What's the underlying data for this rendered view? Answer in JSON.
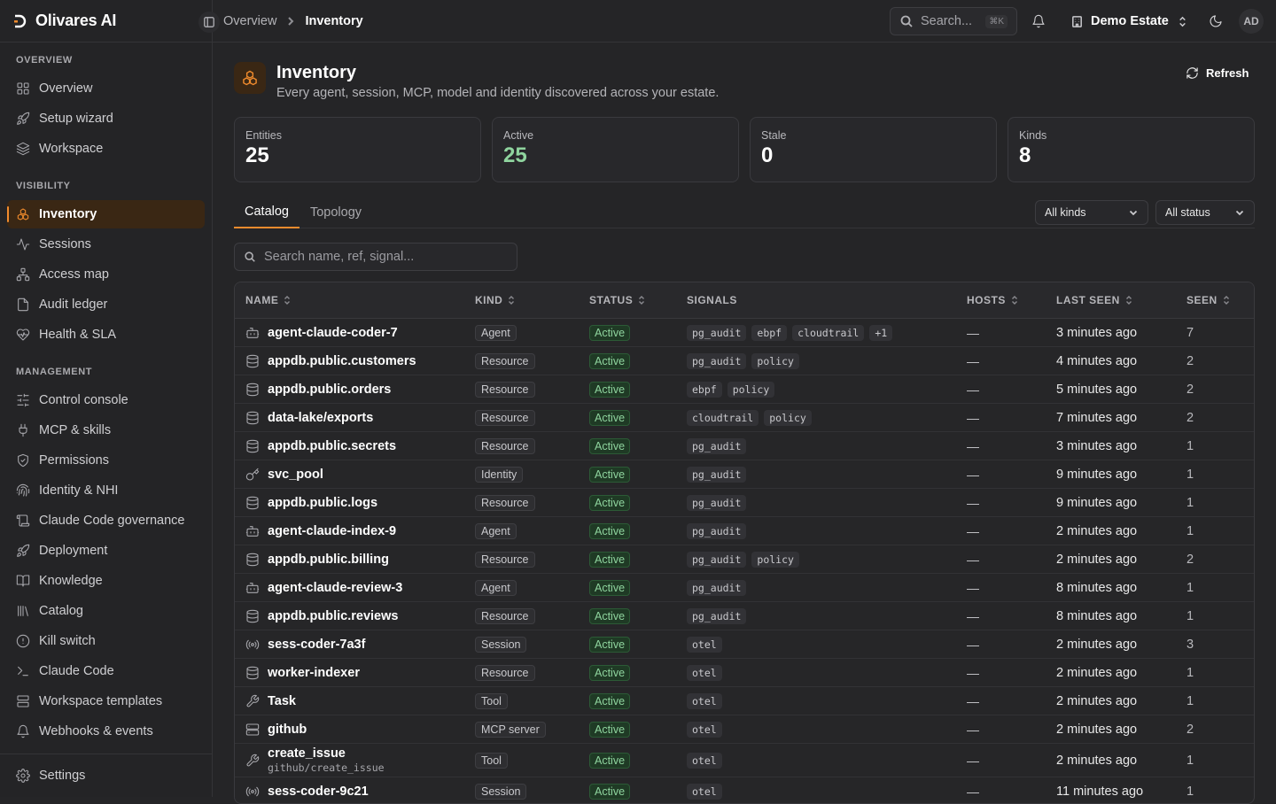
{
  "brand": {
    "name": "Olivares AI"
  },
  "sidebar": {
    "sections": [
      {
        "title": "OVERVIEW",
        "items": [
          {
            "label": "Overview",
            "icon": "grid-icon"
          },
          {
            "label": "Setup wizard",
            "icon": "rocket-icon"
          },
          {
            "label": "Workspace",
            "icon": "layers-icon"
          }
        ]
      },
      {
        "title": "VISIBILITY",
        "items": [
          {
            "label": "Inventory",
            "icon": "boxes-icon",
            "active": true
          },
          {
            "label": "Sessions",
            "icon": "activity-icon"
          },
          {
            "label": "Access map",
            "icon": "network-icon"
          },
          {
            "label": "Audit ledger",
            "icon": "file-icon"
          },
          {
            "label": "Health & SLA",
            "icon": "heart-pulse-icon"
          }
        ]
      },
      {
        "title": "MANAGEMENT",
        "items": [
          {
            "label": "Control console",
            "icon": "sliders-icon"
          },
          {
            "label": "MCP & skills",
            "icon": "plug-icon"
          },
          {
            "label": "Permissions",
            "icon": "shield-icon"
          },
          {
            "label": "Identity & NHI",
            "icon": "fingerprint-icon"
          },
          {
            "label": "Claude Code governance",
            "icon": "scroll-icon"
          },
          {
            "label": "Deployment",
            "icon": "rocket-icon"
          },
          {
            "label": "Knowledge",
            "icon": "book-icon"
          },
          {
            "label": "Catalog",
            "icon": "library-icon"
          },
          {
            "label": "Kill switch",
            "icon": "alert-circle-icon"
          },
          {
            "label": "Claude Code",
            "icon": "terminal-icon"
          },
          {
            "label": "Workspace templates",
            "icon": "layout-icon"
          },
          {
            "label": "Webhooks & events",
            "icon": "bell-icon"
          }
        ]
      }
    ],
    "settings_label": "Settings"
  },
  "topbar": {
    "breadcrumb": [
      "Overview",
      "Inventory"
    ],
    "search_placeholder": "Search...",
    "search_shortcut": "⌘K",
    "estate": "Demo Estate",
    "avatar": "AD"
  },
  "page": {
    "title": "Inventory",
    "subtitle": "Every agent, session, MCP, model and identity discovered across your estate.",
    "refresh_label": "Refresh"
  },
  "stats": [
    {
      "label": "Entities",
      "value": "25"
    },
    {
      "label": "Active",
      "value": "25",
      "color": "#8fd49e"
    },
    {
      "label": "Stale",
      "value": "0"
    },
    {
      "label": "Kinds",
      "value": "8"
    }
  ],
  "tabs": [
    "Catalog",
    "Topology"
  ],
  "filters": {
    "kind": "All kinds",
    "status": "All status"
  },
  "table_search_placeholder": "Search name, ref, signal...",
  "table": {
    "columns": [
      "NAME",
      "KIND",
      "STATUS",
      "SIGNALS",
      "HOSTS",
      "LAST SEEN",
      "SEEN"
    ],
    "rows": [
      {
        "icon": "bot-icon",
        "name": "agent-claude-coder-7",
        "kind": "Agent",
        "status": "Active",
        "signals": [
          "pg_audit",
          "ebpf",
          "cloudtrail",
          "+1"
        ],
        "hosts": "—",
        "last_seen": "3 minutes ago",
        "seen": "7"
      },
      {
        "icon": "database-icon",
        "name": "appdb.public.customers",
        "kind": "Resource",
        "status": "Active",
        "signals": [
          "pg_audit",
          "policy"
        ],
        "hosts": "—",
        "last_seen": "4 minutes ago",
        "seen": "2"
      },
      {
        "icon": "database-icon",
        "name": "appdb.public.orders",
        "kind": "Resource",
        "status": "Active",
        "signals": [
          "ebpf",
          "policy"
        ],
        "hosts": "—",
        "last_seen": "5 minutes ago",
        "seen": "2"
      },
      {
        "icon": "database-icon",
        "name": "data-lake/exports",
        "kind": "Resource",
        "status": "Active",
        "signals": [
          "cloudtrail",
          "policy"
        ],
        "hosts": "—",
        "last_seen": "7 minutes ago",
        "seen": "2"
      },
      {
        "icon": "database-icon",
        "name": "appdb.public.secrets",
        "kind": "Resource",
        "status": "Active",
        "signals": [
          "pg_audit"
        ],
        "hosts": "—",
        "last_seen": "3 minutes ago",
        "seen": "1"
      },
      {
        "icon": "key-icon",
        "name": "svc_pool",
        "kind": "Identity",
        "status": "Active",
        "signals": [
          "pg_audit"
        ],
        "hosts": "—",
        "last_seen": "9 minutes ago",
        "seen": "1"
      },
      {
        "icon": "database-icon",
        "name": "appdb.public.logs",
        "kind": "Resource",
        "status": "Active",
        "signals": [
          "pg_audit"
        ],
        "hosts": "—",
        "last_seen": "9 minutes ago",
        "seen": "1"
      },
      {
        "icon": "bot-icon",
        "name": "agent-claude-index-9",
        "kind": "Agent",
        "status": "Active",
        "signals": [
          "pg_audit"
        ],
        "hosts": "—",
        "last_seen": "2 minutes ago",
        "seen": "1"
      },
      {
        "icon": "database-icon",
        "name": "appdb.public.billing",
        "kind": "Resource",
        "status": "Active",
        "signals": [
          "pg_audit",
          "policy"
        ],
        "hosts": "—",
        "last_seen": "2 minutes ago",
        "seen": "2"
      },
      {
        "icon": "bot-icon",
        "name": "agent-claude-review-3",
        "kind": "Agent",
        "status": "Active",
        "signals": [
          "pg_audit"
        ],
        "hosts": "—",
        "last_seen": "8 minutes ago",
        "seen": "1"
      },
      {
        "icon": "database-icon",
        "name": "appdb.public.reviews",
        "kind": "Resource",
        "status": "Active",
        "signals": [
          "pg_audit"
        ],
        "hosts": "—",
        "last_seen": "8 minutes ago",
        "seen": "1"
      },
      {
        "icon": "radio-icon",
        "name": "sess-coder-7a3f",
        "kind": "Session",
        "status": "Active",
        "signals": [
          "otel"
        ],
        "hosts": "—",
        "last_seen": "2 minutes ago",
        "seen": "3"
      },
      {
        "icon": "database-icon",
        "name": "worker-indexer",
        "kind": "Resource",
        "status": "Active",
        "signals": [
          "otel"
        ],
        "hosts": "—",
        "last_seen": "2 minutes ago",
        "seen": "1"
      },
      {
        "icon": "wrench-icon",
        "name": "Task",
        "kind": "Tool",
        "status": "Active",
        "signals": [
          "otel"
        ],
        "hosts": "—",
        "last_seen": "2 minutes ago",
        "seen": "1"
      },
      {
        "icon": "server-icon",
        "name": "github",
        "kind": "MCP server",
        "status": "Active",
        "signals": [
          "otel"
        ],
        "hosts": "—",
        "last_seen": "2 minutes ago",
        "seen": "2"
      },
      {
        "icon": "wrench-icon",
        "name": "create_issue",
        "ref": "github/create_issue",
        "kind": "Tool",
        "status": "Active",
        "signals": [
          "otel"
        ],
        "hosts": "—",
        "last_seen": "2 minutes ago",
        "seen": "1"
      },
      {
        "icon": "radio-icon",
        "name": "sess-coder-9c21",
        "kind": "Session",
        "status": "Active",
        "signals": [
          "otel"
        ],
        "hosts": "—",
        "last_seen": "11 minutes ago",
        "seen": "1"
      }
    ]
  }
}
